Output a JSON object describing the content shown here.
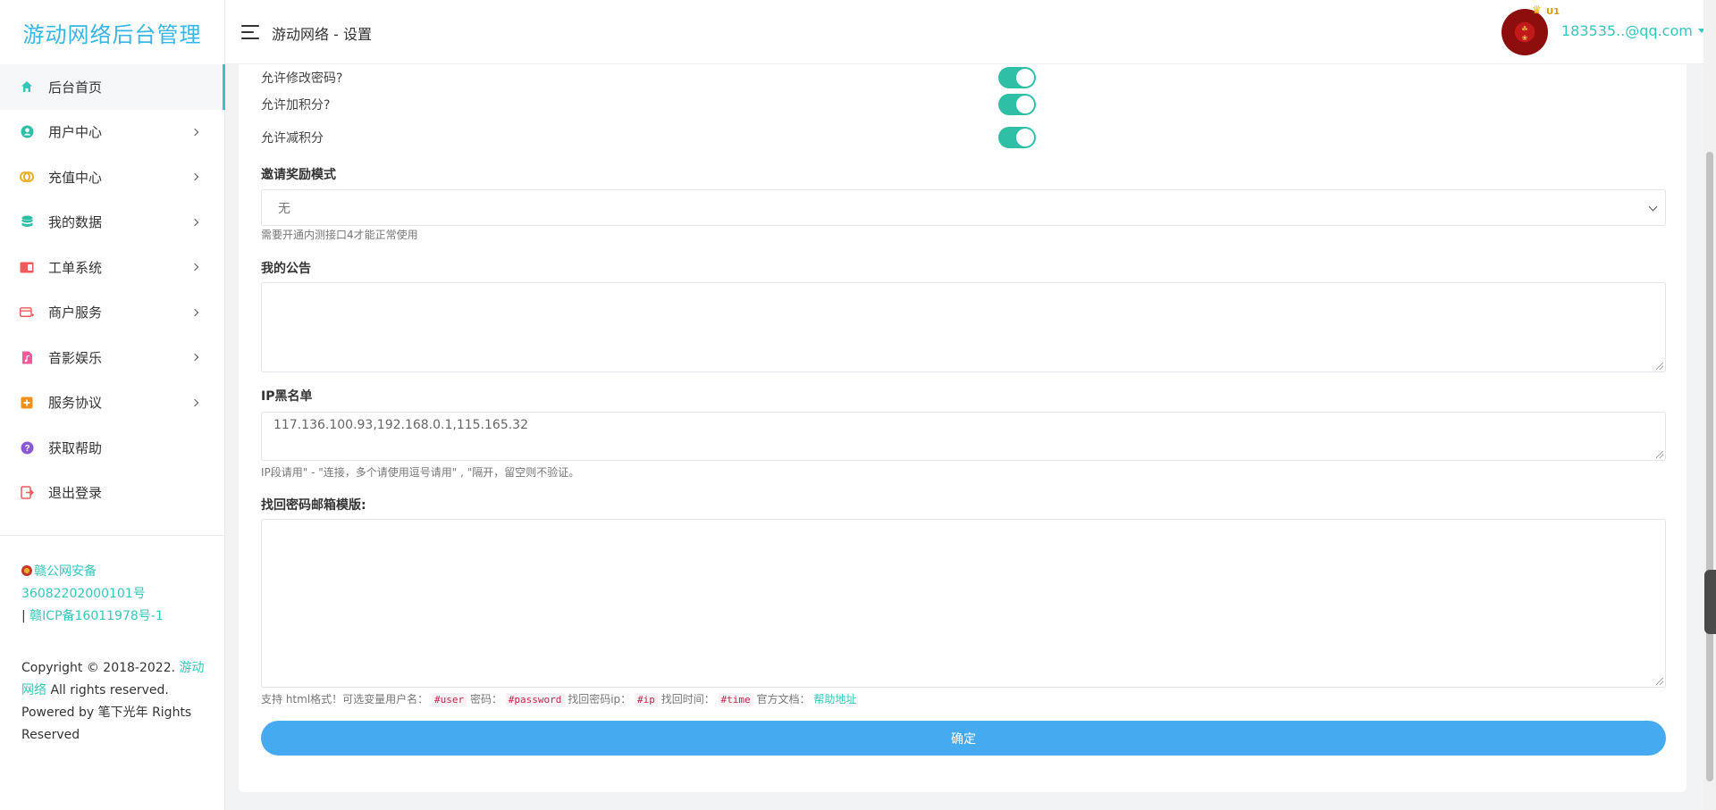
{
  "brand": "游动网络后台管理",
  "header": {
    "title": "游动网络 - 设置",
    "user_email": "183535..@qq.com",
    "vip_level": "U1"
  },
  "sidebar": {
    "items": [
      {
        "label": "后台首页",
        "icon": "home-icon",
        "color": "#36c6bb"
      },
      {
        "label": "用户中心",
        "icon": "user-circle-icon",
        "color": "#2fbfa6"
      },
      {
        "label": "充值中心",
        "icon": "recharge-icon",
        "color": "#e8b02a"
      },
      {
        "label": "我的数据",
        "icon": "database-icon",
        "color": "#2fbfa6"
      },
      {
        "label": "工单系统",
        "icon": "ticket-icon",
        "color": "#f05a5a"
      },
      {
        "label": "商户服务",
        "icon": "card-icon",
        "color": "#f05a5a"
      },
      {
        "label": "音影娱乐",
        "icon": "music-file-icon",
        "color": "#f05a9a"
      },
      {
        "label": "服务协议",
        "icon": "plus-square-icon",
        "color": "#f0901a"
      },
      {
        "label": "获取帮助",
        "icon": "question-icon",
        "color": "#8a5ad6"
      },
      {
        "label": "退出登录",
        "icon": "logout-icon",
        "color": "#f05a5a"
      }
    ],
    "beian_police": "赣公网安备 36082202000101号",
    "beian_sep": "|",
    "beian_icp": "赣ICP备16011978号-1",
    "copyright_prefix": "Copyright © 2018-2022.",
    "copyright_brand": "游动网络",
    "copyright_suffix": "All rights reserved.",
    "powered_prefix": "Powered by",
    "powered_brand": "笔下光年",
    "powered_suffix": "Rights Reserved"
  },
  "form": {
    "toggles": [
      {
        "label": "允许修改密码?",
        "on": true
      },
      {
        "label": "允许加积分?",
        "on": true
      },
      {
        "label": "允许减积分",
        "on": true
      }
    ],
    "invite_label": "邀请奖励模式",
    "invite_value": "无",
    "invite_help": "需要开通内测接口4才能正常使用",
    "notice_label": "我的公告",
    "notice_value": "",
    "ip_label": "IP黑名单",
    "ip_value": "117.136.100.93,192.168.0.1,115.165.32",
    "ip_help": "IP段请用\" - \"连接，多个请使用逗号请用\" , \"隔开，留空则不验证。",
    "email_label": "找回密码邮箱模版:",
    "email_value": "",
    "email_help_1": "支持 html格式！可选变量用户名：",
    "var_user": "#user",
    "email_help_2": "密码：",
    "var_password": "#password",
    "email_help_3": "找回密码ip：",
    "var_ip": "#ip",
    "email_help_4": "找回时间：",
    "var_time": "#time",
    "email_help_5": "官方文档：",
    "email_help_link": "帮助地址",
    "submit_label": "确定"
  }
}
